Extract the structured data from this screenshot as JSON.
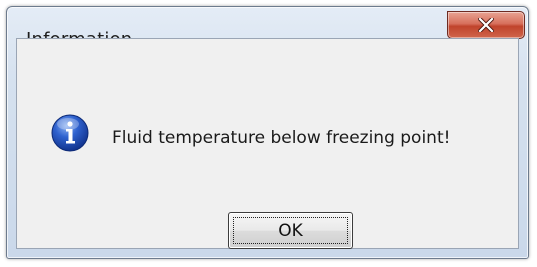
{
  "dialog": {
    "title": "Information",
    "message": "Fluid temperature below freezing point!",
    "ok_label": "OK",
    "icon": "information-icon",
    "close_icon": "close-icon"
  },
  "colors": {
    "close_button": "#c8482f",
    "icon_blue": "#1f4fb8",
    "client_bg": "#f0f0f0"
  }
}
